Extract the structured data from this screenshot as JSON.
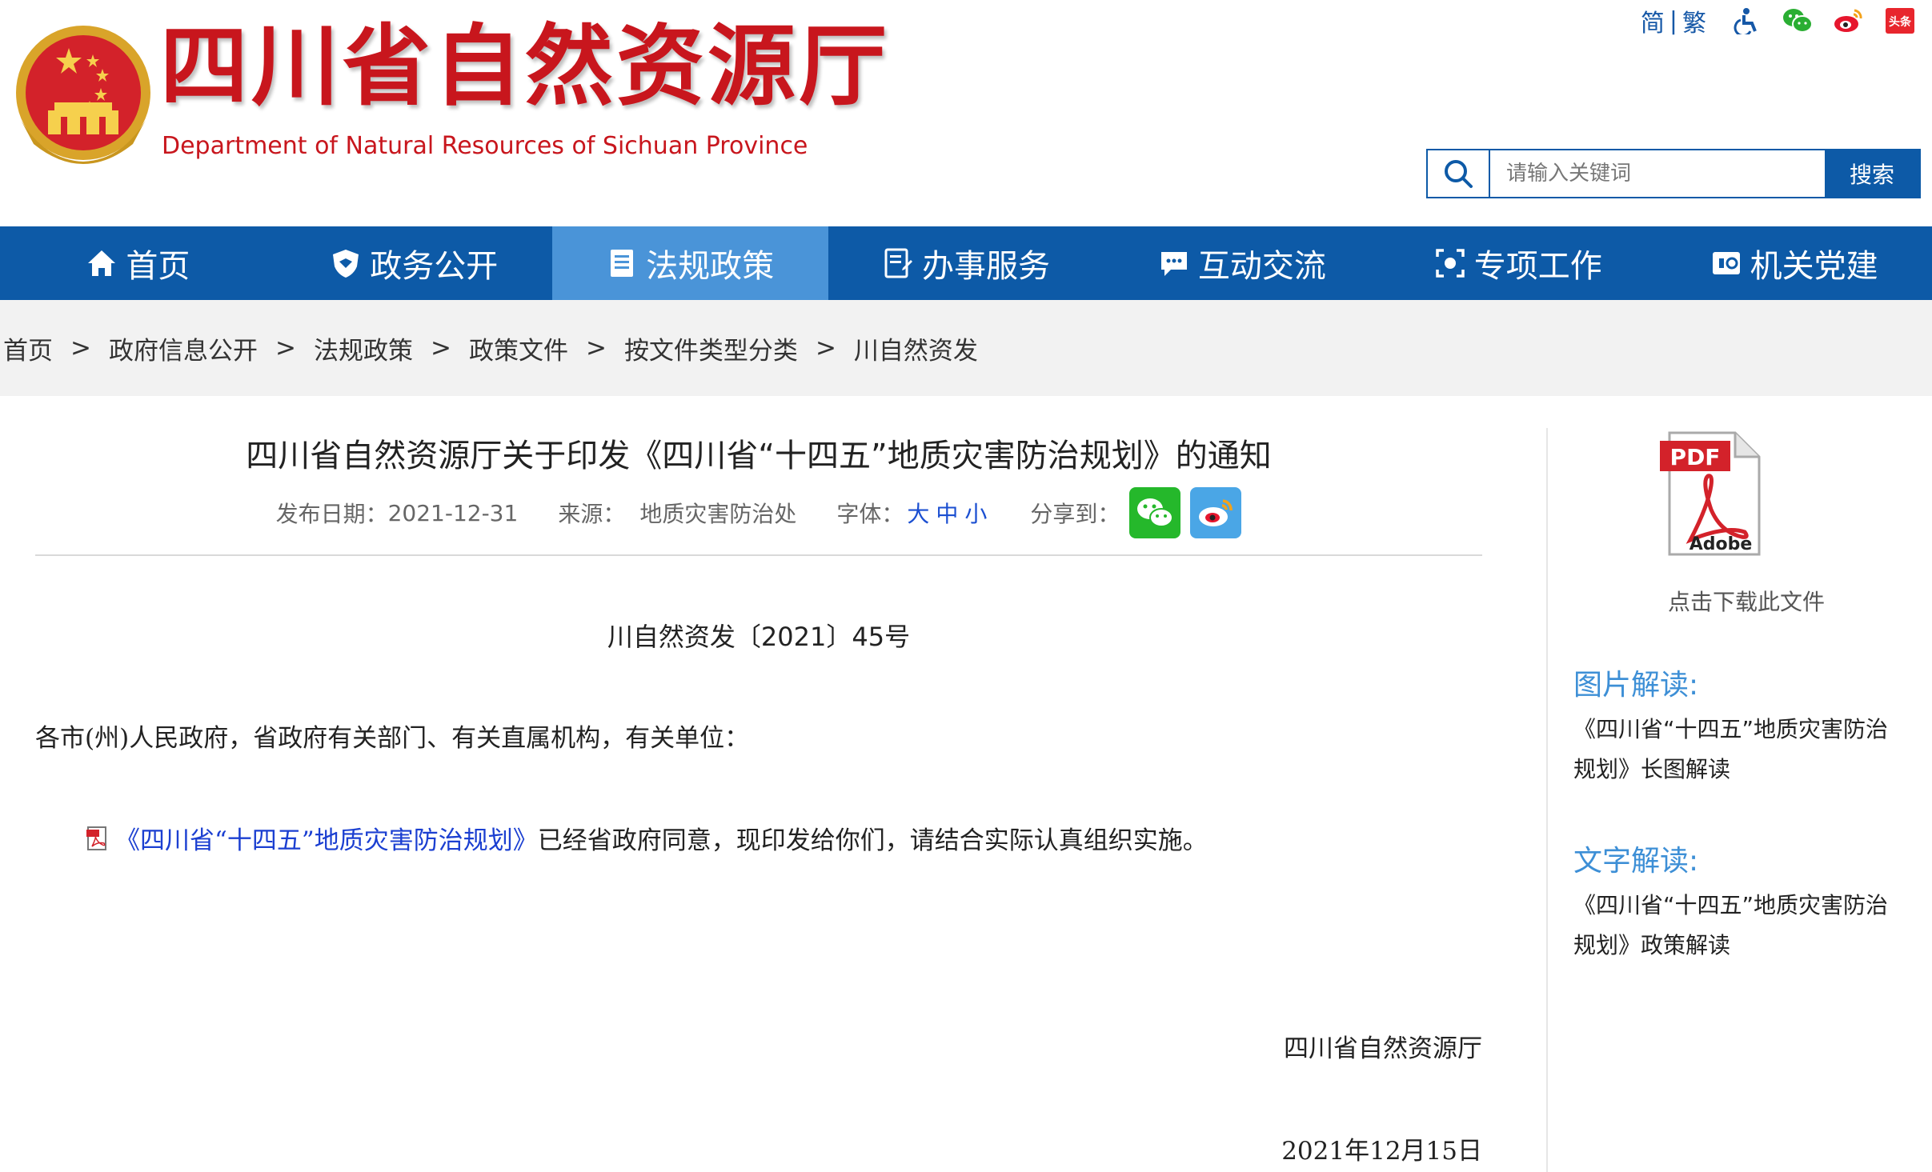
{
  "header": {
    "title": "四川省自然资源厅",
    "subtitle": "Department of Natural Resources of Sichuan Province",
    "lang_simplified": "简",
    "lang_separator": "|",
    "lang_traditional": "繁",
    "search_placeholder": "请输入关键词",
    "search_button": "搜索",
    "icons": [
      "accessibility-icon",
      "wechat-icon",
      "weibo-icon",
      "toutiao-icon"
    ],
    "toutiao_label": "头条"
  },
  "nav": {
    "items": [
      {
        "label": "首页",
        "icon": "home-icon"
      },
      {
        "label": "政务公开",
        "icon": "shield-icon"
      },
      {
        "label": "法规政策",
        "icon": "document-icon"
      },
      {
        "label": "办事服务",
        "icon": "form-icon"
      },
      {
        "label": "互动交流",
        "icon": "chat-icon"
      },
      {
        "label": "专项工作",
        "icon": "focus-icon"
      },
      {
        "label": "机关党建",
        "icon": "party-icon"
      }
    ],
    "active_index": 2
  },
  "breadcrumb": {
    "items": [
      "首页",
      "政府信息公开",
      "法规政策",
      "政策文件",
      "按文件类型分类",
      "川自然资发"
    ],
    "separator": ">"
  },
  "article": {
    "title": "四川省自然资源厅关于印发《四川省“十四五”地质灾害防治规划》的通知",
    "date_label": "发布日期：",
    "date": "2021-12-31",
    "source_label": "来源：",
    "source": "地质灾害防治处",
    "font_label": "字体：",
    "font_large": "大",
    "font_medium": "中",
    "font_small": "小",
    "share_label": "分享到：",
    "doc_number": "川自然资发〔2021〕45号",
    "salutation": "各市(州)人民政府，省政府有关部门、有关直属机构，有关单位：",
    "body_link": "《四川省“十四五”地质灾害防治规划》",
    "body_text": "已经省政府同意，现印发给你们，请结合实际认真组织实施。",
    "sign_org": "四川省自然资源厅",
    "sign_date": "2021年12月15日"
  },
  "sidebar": {
    "pdf_label": "PDF",
    "pdf_brand": "Adobe",
    "pdf_caption": "点击下载此文件",
    "image_heading": "图片解读:",
    "image_link": "《四川省“十四五”地质灾害防治规划》长图解读",
    "text_heading": "文字解读:",
    "text_link": "《四川省“十四五”地质灾害防治规划》政策解读"
  },
  "colors": {
    "brand_red": "#c8161d",
    "nav_blue": "#0d5aa7",
    "nav_active": "#4a94d8",
    "link_blue": "#1b3fd1",
    "side_heading": "#3d8fd6"
  }
}
